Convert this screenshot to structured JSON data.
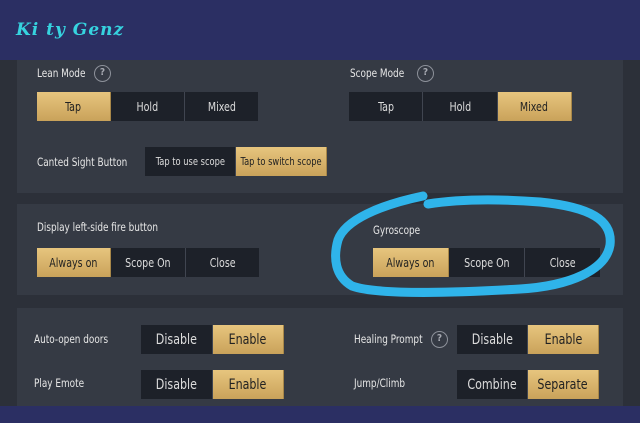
{
  "brand": "Ki ty Genz",
  "help_glyph": "?",
  "colors": {
    "accent_gold": "#d8b56d",
    "highlight_stroke": "#2fb4ea",
    "brand_text": "#36d3df"
  },
  "lean_mode": {
    "label": "Lean Mode",
    "options": [
      "Tap",
      "Hold",
      "Mixed"
    ],
    "selected": "Tap"
  },
  "scope_mode": {
    "label": "Scope Mode",
    "options": [
      "Tap",
      "Hold",
      "Mixed"
    ],
    "selected": "Mixed"
  },
  "canted_sight": {
    "label": "Canted Sight Button",
    "options": [
      "Tap to use scope",
      "Tap to switch scope"
    ],
    "selected": "Tap to switch scope"
  },
  "left_fire": {
    "label": "Display left-side fire button",
    "options": [
      "Always on",
      "Scope On",
      "Close"
    ],
    "selected": "Always on"
  },
  "gyroscope": {
    "label": "Gyroscope",
    "options": [
      "Always on",
      "Scope On",
      "Close"
    ],
    "selected": "Always on"
  },
  "auto_doors": {
    "label": "Auto-open doors",
    "options": [
      "Disable",
      "Enable"
    ],
    "selected": "Enable"
  },
  "healing_prompt": {
    "label": "Healing Prompt",
    "options": [
      "Disable",
      "Enable"
    ],
    "selected": "Enable"
  },
  "play_emote": {
    "label": "Play Emote",
    "options": [
      "Disable",
      "Enable"
    ],
    "selected": "Enable"
  },
  "jump_climb": {
    "label": "Jump/Climb",
    "options": [
      "Combine",
      "Separate"
    ],
    "selected": "Separate"
  }
}
